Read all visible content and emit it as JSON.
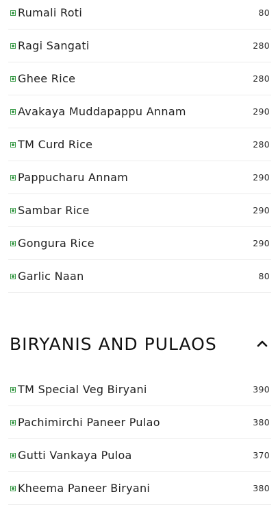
{
  "sections": [
    {
      "title": "",
      "items": [
        {
          "name": "Rumali Roti",
          "price": "80"
        },
        {
          "name": "Ragi Sangati",
          "price": "280"
        },
        {
          "name": "Ghee Rice",
          "price": "280"
        },
        {
          "name": "Avakaya Muddapappu Annam",
          "price": "290"
        },
        {
          "name": "TM Curd Rice",
          "price": "280"
        },
        {
          "name": "Pappucharu Annam",
          "price": "290"
        },
        {
          "name": "Sambar Rice",
          "price": "290"
        },
        {
          "name": "Gongura Rice",
          "price": "290"
        },
        {
          "name": "Garlic Naan",
          "price": "80"
        }
      ]
    },
    {
      "title": "BIRYANIS AND PULAOS",
      "items": [
        {
          "name": "TM Special Veg Biryani",
          "price": "390"
        },
        {
          "name": "Pachimirchi Paneer Pulao",
          "price": "380"
        },
        {
          "name": "Gutti Vankaya Puloa",
          "price": "370"
        },
        {
          "name": "Kheema Paneer Biryani",
          "price": "380"
        }
      ]
    }
  ],
  "icons": {
    "veg": "veg-mark-icon",
    "collapse": "chevron-up-icon"
  },
  "colors": {
    "veg_green": "#3a9a48",
    "divider": "#ececec"
  }
}
